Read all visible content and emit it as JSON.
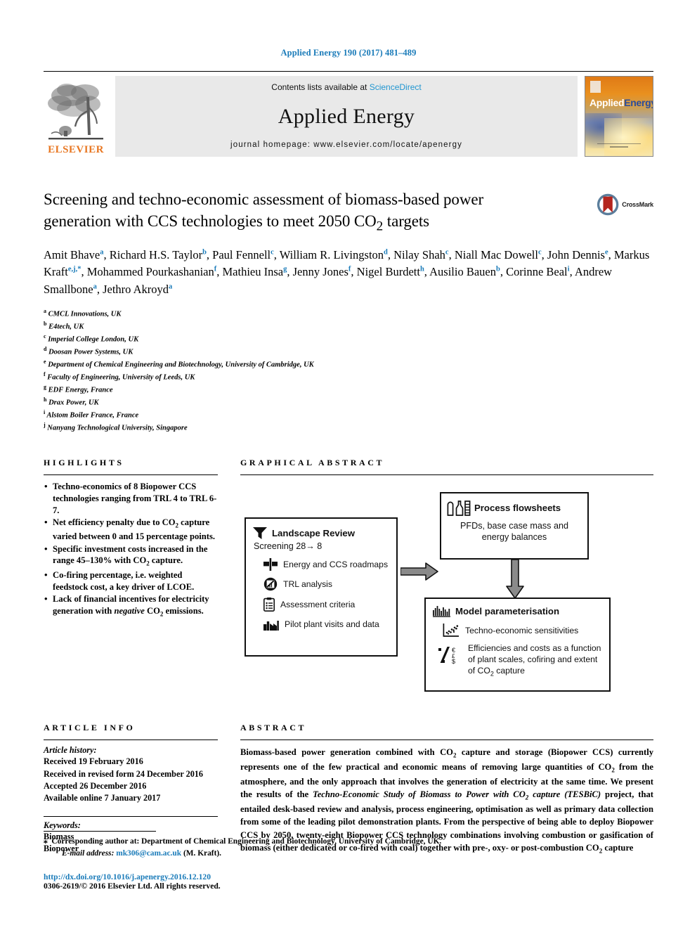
{
  "running_head": "Applied Energy 190 (2017) 481–489",
  "masthead": {
    "publisher_name": "ELSEVIER",
    "contents_prefix": "Contents lists available at ",
    "contents_link": "ScienceDirect",
    "journal_name": "Applied Energy",
    "homepage_line": "journal homepage: www.elsevier.com/locate/apenergy",
    "cover": {
      "word_white": "Applied",
      "word_blue": "Energy"
    },
    "colors": {
      "link_blue": "#2196d1",
      "elsevier_orange": "#e87722",
      "panel_gray": "#e9e9e9"
    }
  },
  "article": {
    "title_line1": "Screening and techno-economic assessment of biomass-based power",
    "title_line2_a": "generation with CCS technologies to meet 2050 CO",
    "title_line2_sub": "2",
    "title_line2_b": " targets",
    "crossmark_label": "CrossMark",
    "authors": [
      {
        "name": "Amit Bhave",
        "sup": "a"
      },
      {
        "name": "Richard H.S. Taylor",
        "sup": "b"
      },
      {
        "name": "Paul Fennell",
        "sup": "c"
      },
      {
        "name": "William R. Livingston",
        "sup": "d"
      },
      {
        "name": "Nilay Shah",
        "sup": "c"
      },
      {
        "name": "Niall Mac Dowell",
        "sup": "c"
      },
      {
        "name": "John Dennis",
        "sup": "e"
      },
      {
        "name": "Markus Kraft",
        "sup": "e,j,*"
      },
      {
        "name": "Mohammed Pourkashanian",
        "sup": "f"
      },
      {
        "name": "Mathieu Insa",
        "sup": "g"
      },
      {
        "name": "Jenny Jones",
        "sup": "f"
      },
      {
        "name": "Nigel Burdett",
        "sup": "h"
      },
      {
        "name": "Ausilio Bauen",
        "sup": "b"
      },
      {
        "name": "Corinne Beal",
        "sup": "i"
      },
      {
        "name": "Andrew Smallbone",
        "sup": "a"
      },
      {
        "name": "Jethro Akroyd",
        "sup": "a"
      }
    ],
    "affiliations": [
      {
        "sup": "a",
        "text": "CMCL Innovations, UK"
      },
      {
        "sup": "b",
        "text": "E4tech, UK"
      },
      {
        "sup": "c",
        "text": "Imperial College London, UK"
      },
      {
        "sup": "d",
        "text": "Doosan Power Systems, UK"
      },
      {
        "sup": "e",
        "text": "Department of Chemical Engineering and Biotechnology, University of Cambridge, UK"
      },
      {
        "sup": "f",
        "text": "Faculty of Engineering, University of Leeds, UK"
      },
      {
        "sup": "g",
        "text": "EDF Energy, France"
      },
      {
        "sup": "h",
        "text": "Drax Power, UK"
      },
      {
        "sup": "i",
        "text": "Alstom Boiler France, France"
      },
      {
        "sup": "j",
        "text": "Nanyang Technological University, Singapore"
      }
    ]
  },
  "highlights": {
    "heading": "HIGHLIGHTS",
    "items": [
      "Techno-economics of 8 Biopower CCS technologies ranging from TRL 4 to TRL 6-7.",
      "Net efficiency penalty due to CO2 capture varied between 0 and 15 percentage points.",
      "Specific investment costs increased in the range 45–130% with CO2 capture.",
      "Co-firing percentage, i.e. weighted feedstock cost, a key driver of LCOE.",
      "Lack of financial incentives for electricity generation with negative CO2 emissions."
    ]
  },
  "graphical_abstract": {
    "heading": "GRAPHICAL ABSTRACT",
    "boxes": {
      "landscape": {
        "title": "Landscape Review",
        "subtitle": "Screening 28→ 8",
        "icon": "funnel-icon",
        "rows": [
          {
            "label": "Energy and CCS roadmaps",
            "icon": "signpost-icon"
          },
          {
            "label": "TRL analysis",
            "icon": "gauge-icon"
          },
          {
            "label": "Assessment criteria",
            "icon": "clipboard-icon"
          },
          {
            "label": "Pilot plant visits and data",
            "icon": "factory-icon"
          }
        ]
      },
      "flowsheets": {
        "title": "Process flowsheets",
        "icon": "process-plant-icon",
        "body_line1": "PFDs, base case mass and",
        "body_line2": "energy balances"
      },
      "model": {
        "title": "Model parameterisation",
        "icon": "histogram-icon",
        "rows": [
          {
            "label": "Techno-economic sensitivities",
            "icon": "scatter-plot-icon"
          },
          {
            "label": "Efficiencies and costs as a function of plant scales, cofiring and extent of CO2 capture",
            "icon": "percent-currency-icon"
          }
        ]
      }
    }
  },
  "article_info": {
    "heading": "ARTICLE INFO",
    "history_label": "Article history:",
    "history": [
      "Received 19 February 2016",
      "Received in revised form 24 December 2016",
      "Accepted 26 December 2016",
      "Available online 7 January 2017"
    ],
    "keywords_label": "Keywords:",
    "keywords": [
      "Biomass",
      "Biopower"
    ]
  },
  "abstract": {
    "heading": "ABSTRACT",
    "text_part1": "Biomass-based power generation combined with CO",
    "text_part2": " capture and storage (Biopower CCS) currently represents one of the few practical and economic means of removing large quantities of CO",
    "text_part3": " from the atmosphere, and the only approach that involves the generation of electricity at the same time. We present the results of the ",
    "italic_part": "Techno-Economic Study of Biomass to Power with CO",
    "italic_part_b": " capture (TESBiC)",
    "text_part4": " project, that entailed desk-based review and analysis, process engineering, optimisation as well as primary data collection from some of the leading pilot demonstration plants. From the perspective of being able to deploy Biopower CCS by 2050, twenty-eight Biopower CCS technology combinations involving combustion or gasification of biomass (either dedicated or co-fired with coal) together with pre-, oxy- or post-combustion CO",
    "text_part5": " capture"
  },
  "footer": {
    "corresponding_mark": "⁎",
    "corresponding_text": "Corresponding author at: Department of Chemical Engineering and Biotechnology, University of Cambridge, UK.",
    "email_label": "E-mail address:",
    "email": "mk306@cam.ac.uk",
    "email_owner": "(M. Kraft).",
    "doi": "http://dx.doi.org/10.1016/j.apenergy.2016.12.120",
    "copyright": "0306-2619/© 2016 Elsevier Ltd. All rights reserved."
  }
}
